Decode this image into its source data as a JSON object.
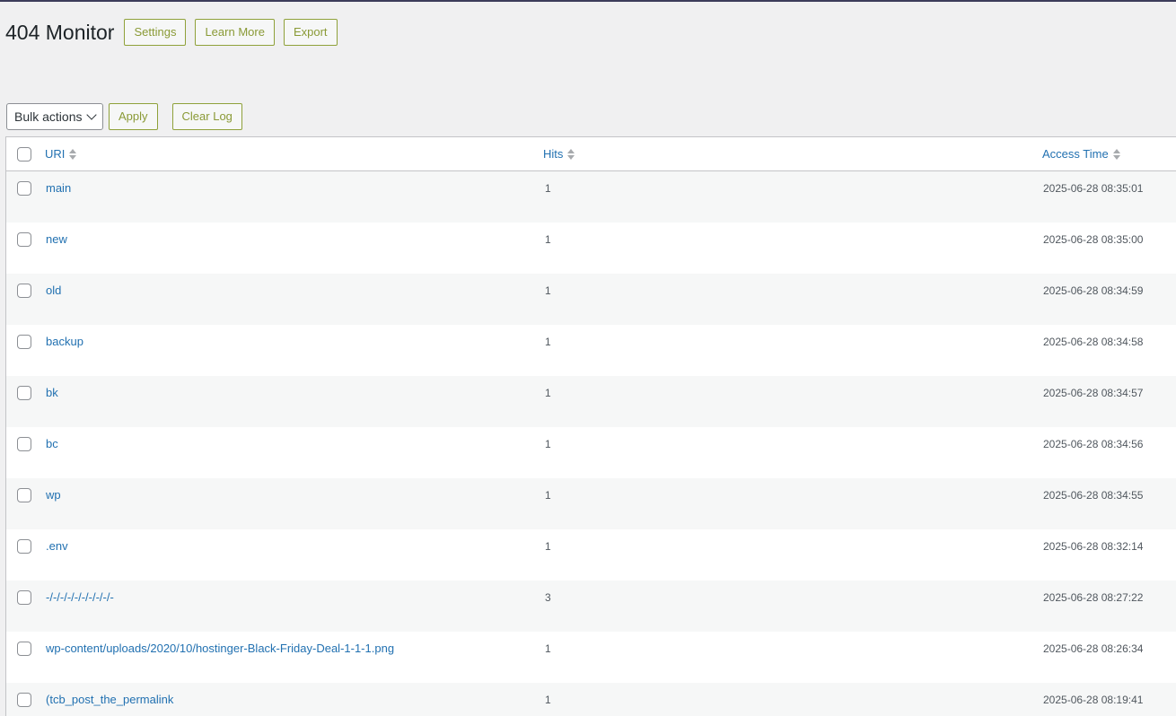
{
  "header": {
    "title": "404 Monitor",
    "settings_label": "Settings",
    "learn_more_label": "Learn More",
    "export_label": "Export"
  },
  "toolbar": {
    "bulk_actions_label": "Bulk actions",
    "apply_label": "Apply",
    "clear_log_label": "Clear Log"
  },
  "table": {
    "columns": {
      "uri": "URI",
      "hits": "Hits",
      "access_time": "Access Time"
    },
    "rows": [
      {
        "uri": "main",
        "hits": "1",
        "time": "2025-06-28 08:35:01"
      },
      {
        "uri": "new",
        "hits": "1",
        "time": "2025-06-28 08:35:00"
      },
      {
        "uri": "old",
        "hits": "1",
        "time": "2025-06-28 08:34:59"
      },
      {
        "uri": "backup",
        "hits": "1",
        "time": "2025-06-28 08:34:58"
      },
      {
        "uri": "bk",
        "hits": "1",
        "time": "2025-06-28 08:34:57"
      },
      {
        "uri": "bc",
        "hits": "1",
        "time": "2025-06-28 08:34:56"
      },
      {
        "uri": "wp",
        "hits": "1",
        "time": "2025-06-28 08:34:55"
      },
      {
        "uri": ".env",
        "hits": "1",
        "time": "2025-06-28 08:32:14"
      },
      {
        "uri": "-/-/-/-/-/-/-/-/-/-",
        "hits": "3",
        "time": "2025-06-28 08:27:22"
      },
      {
        "uri": "wp-content/uploads/2020/10/hostinger-Black-Friday-Deal-1-1-1.png",
        "hits": "1",
        "time": "2025-06-28 08:26:34"
      },
      {
        "uri": "(tcb_post_the_permalink",
        "hits": "1",
        "time": "2025-06-28 08:19:41"
      }
    ]
  },
  "colors": {
    "link": "#2271b1",
    "outline_button": "#8a9a36",
    "background": "#f0f0f1"
  }
}
